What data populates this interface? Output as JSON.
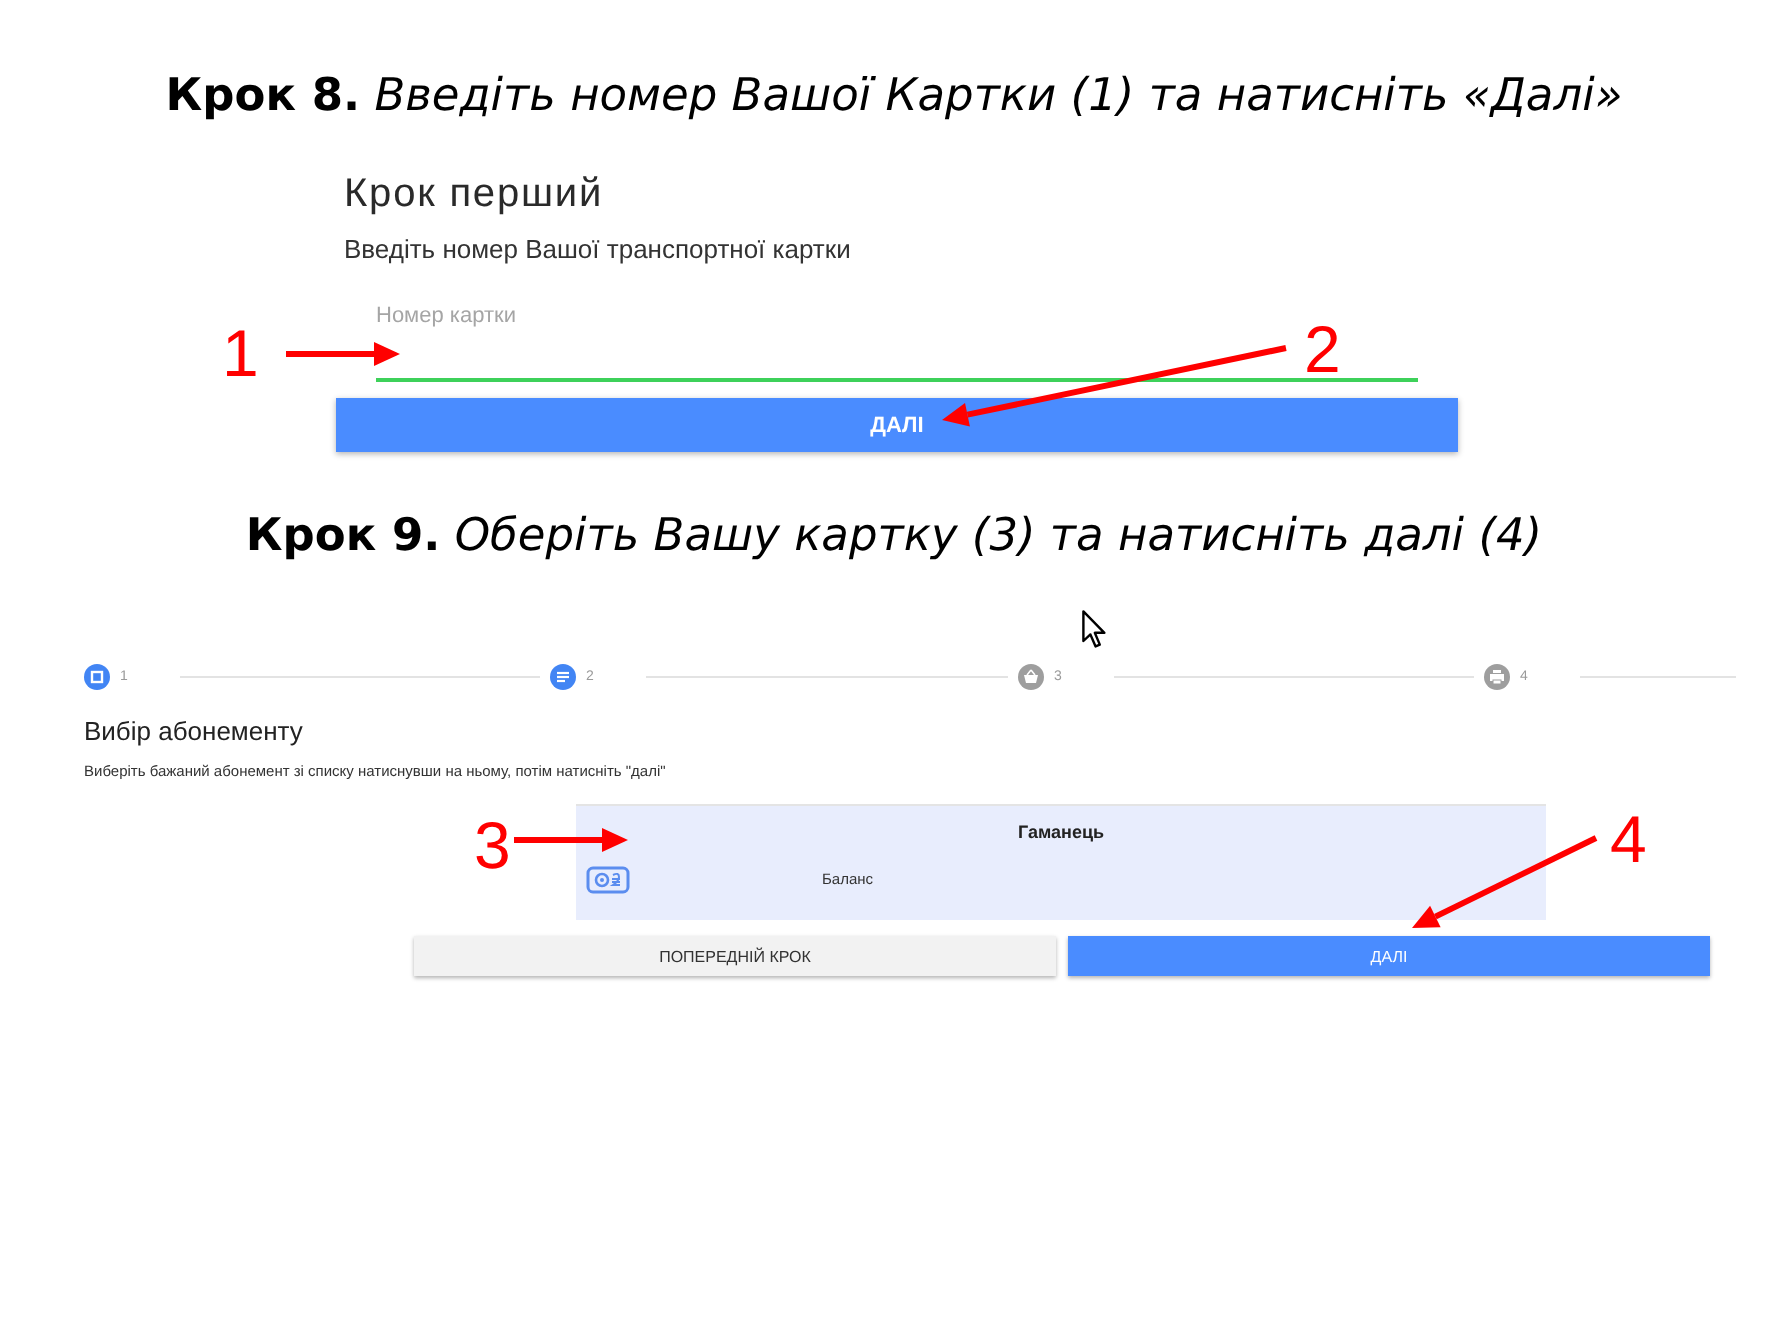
{
  "step_8": {
    "heading": "**Крок 8.** *Введіть номер Вашої Картки (1) та натисніть «Далі»*",
    "screenshot": {
      "title": "Крок перший",
      "subtitle": "Введіть номер Вашої транспортної картки",
      "card_number_field": {
        "placeholder": "Номер картки",
        "focused": true
      },
      "button": "ДАЛІ"
    },
    "callouts": [
      {
        "label": "1"
      },
      {
        "label": "2"
      }
    ]
  },
  "step_9": {
    "heading": "**Крок 9.** *Оберіть Вашу картку (3) та натисніть далі (4)*",
    "screenshot": {
      "stepper": [
        {
          "number": "1",
          "active": true
        },
        {
          "number": "2",
          "active": true
        },
        {
          "number": "3",
          "active": false
        },
        {
          "number": "4",
          "active": false
        }
      ],
      "title": "Вибір абонементу",
      "hint": "Виберіть бажаний абонемент зі списку натиснувши на ньому, потім натисніть \"далі\"",
      "options": [
        {
          "title": "Гаманець",
          "label": "Баланс",
          "selected": true
        }
      ],
      "buttons": [
        {
          "label": "ПОПЕРЕДНІЙ КРОК",
          "kind": "secondary"
        },
        {
          "label": "ДАЛІ",
          "kind": "primary"
        }
      ]
    },
    "callouts": [
      {
        "label": "3"
      },
      {
        "label": "4"
      }
    ]
  }
}
